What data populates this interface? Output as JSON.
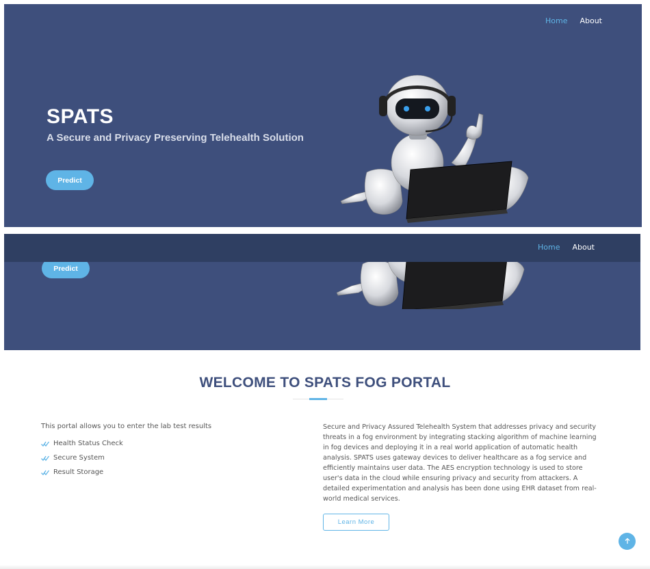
{
  "nav": {
    "home_label": "Home",
    "about_label": "About"
  },
  "hero": {
    "title": "SPATS",
    "subtitle": "A Secure and Privacy Preserving Telehealth Solution",
    "predict_label": "Predict"
  },
  "welcome": {
    "heading": "WELCOME TO SPATS FOG PORTAL"
  },
  "features": {
    "intro": "This portal allows you to enter the lab test results",
    "items": [
      {
        "label": "Health Status Check",
        "icon": "double-check-icon"
      },
      {
        "label": "Secure System",
        "icon": "double-check-icon"
      },
      {
        "label": "Result Storage",
        "icon": "double-check-icon"
      }
    ]
  },
  "about": {
    "text": "Secure and Privacy Assured Telehealth System that addresses privacy and security threats in a fog environment by integrating stacking algorithm of machine learning in fog devices and deploying it in a real world application of automatic health analysis. SPATS uses gateway devices to deliver healthcare as a fog service and efficiently maintains user data. The AES encryption technology is used to store user's data in the cloud while ensuring privacy and security from attackers. A detailed experimentation and analysis has been done using EHR dataset from real-world medical services.",
    "learn_more_label": "Learn More"
  },
  "back_to_top_icon": "arrow-up-icon",
  "colors": {
    "hero_bg": "#3e4f7c",
    "sticky_bg": "#2f3f62",
    "accent": "#5fb4e6",
    "heading": "#3e4f7c"
  }
}
